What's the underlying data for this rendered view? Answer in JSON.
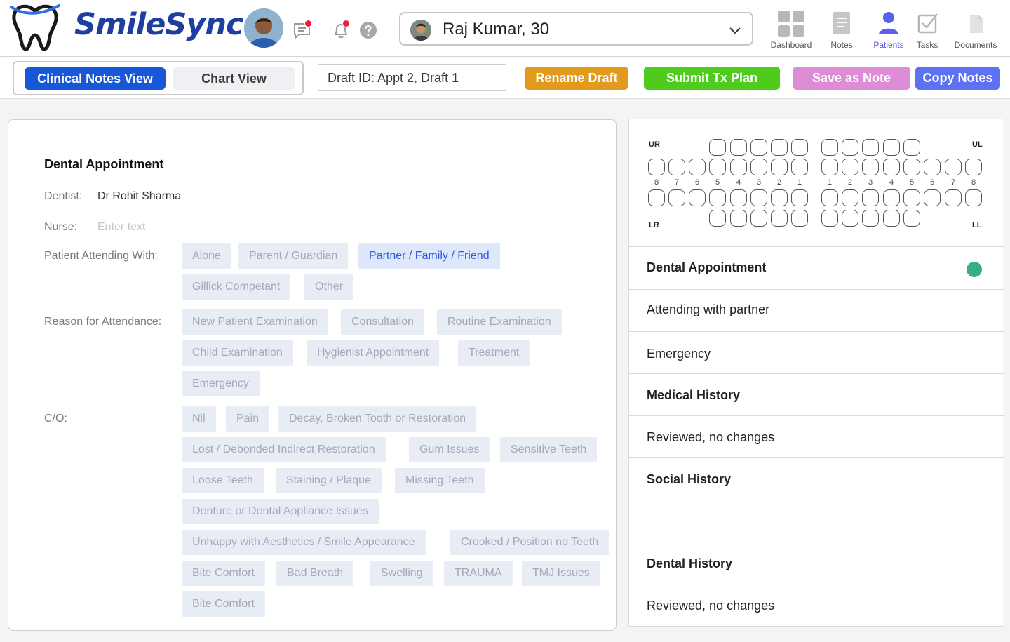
{
  "app": {
    "name": "SmileSync",
    "accent": "#1857d8",
    "brand_color": "#1e3fa0"
  },
  "header": {
    "patient_select": {
      "value": "Raj Kumar, 30"
    },
    "nav": [
      {
        "label": "Dashboard",
        "icon": "dashboard-icon"
      },
      {
        "label": "Notes",
        "icon": "notes-icon"
      },
      {
        "label": "Patients",
        "icon": "patients-icon",
        "active": true
      },
      {
        "label": "Tasks",
        "icon": "tasks-icon"
      },
      {
        "label": "Documents",
        "icon": "documents-icon"
      }
    ]
  },
  "toolbar": {
    "views": {
      "clinical": "Clinical Notes View",
      "chart": "Chart View",
      "selected": "Clinical Notes View"
    },
    "draft_id": "Draft ID: Appt 2, Draft 1",
    "buttons": [
      {
        "label": "Rename Draft",
        "color": "#e19a1c"
      },
      {
        "label": "Submit Tx Plan",
        "color": "#4fcb1d"
      },
      {
        "label": "Save as Note",
        "color": "#dd8dd6"
      },
      {
        "label": "Copy Notes",
        "color": "#5c72f2"
      }
    ]
  },
  "form": {
    "title": "Dental Appointment",
    "dentist_label": "Dentist:",
    "dentist_value": "Dr Rohit Sharma",
    "nurse_label": "Nurse:",
    "nurse_placeholder": "Enter text",
    "attending_label": "Patient Attending With:",
    "attending_options": [
      "Alone",
      "Parent / Guardian",
      "Partner / Family / Friend",
      "Gillick Competant",
      "Other"
    ],
    "attending_selected": "Partner / Family / Friend",
    "reason_label": "Reason for Attendance:",
    "reason_options": [
      "New Patient Examination",
      "Consultation",
      "Routine Examination",
      "Child Examination",
      "Hygienist Appointment",
      "Treatment",
      "Emergency"
    ],
    "co_label": "C/O:",
    "co_options": [
      "Nil",
      "Pain",
      "Decay, Broken Tooth or Restoration",
      "Lost / Debonded Indirect Restoration",
      "Gum Issues",
      "Sensitive Teeth",
      "Loose Teeth",
      "Staining / Plaque",
      "Missing Teeth",
      "Denture or Dental Appliance Issues",
      "Unhappy with Aesthetics / Smile Appearance",
      "Crooked / Position no Teeth",
      "Bite Comfort",
      "Bad Breath",
      "Swelling",
      "TRAUMA",
      "TMJ Issues",
      "Bite Comfort"
    ]
  },
  "tooth_chart": {
    "quadrants": {
      "ur": "UR",
      "ul": "UL",
      "lr": "LR",
      "ll": "LL"
    },
    "right_numbers": [
      "8",
      "7",
      "6",
      "5",
      "4",
      "3",
      "2",
      "1"
    ],
    "left_numbers": [
      "1",
      "2",
      "3",
      "4",
      "5",
      "6",
      "7",
      "8"
    ]
  },
  "summary": [
    {
      "text": "Dental Appointment",
      "header": true,
      "status_color": "#35b07f"
    },
    {
      "text": "Attending with partner",
      "header": false
    },
    {
      "text": "Emergency",
      "header": false
    },
    {
      "text": "Medical History",
      "header": true
    },
    {
      "text": "Reviewed, no changes",
      "header": false
    },
    {
      "text": "Social History",
      "header": true
    },
    {
      "text": "",
      "header": false
    },
    {
      "text": "Dental History",
      "header": true
    },
    {
      "text": "Reviewed, no changes",
      "header": false
    }
  ]
}
